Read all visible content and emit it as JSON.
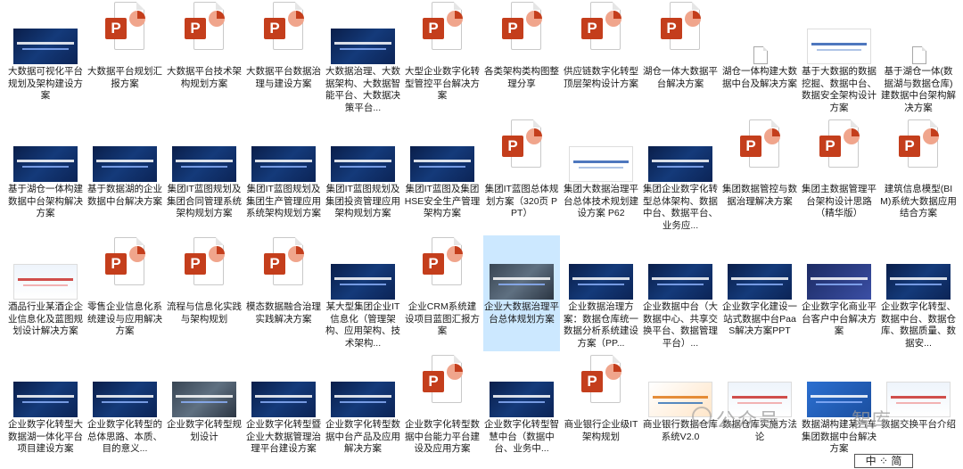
{
  "files": [
    {
      "row": 0,
      "col": 0,
      "thumb": "slide",
      "label": "大数据可视化平台规划及架构建设方案"
    },
    {
      "row": 0,
      "col": 1,
      "thumb": "ppt",
      "label": "大数据平台规划汇报方案"
    },
    {
      "row": 0,
      "col": 2,
      "thumb": "ppt",
      "label": "大数据平台技术架构规划方案"
    },
    {
      "row": 0,
      "col": 3,
      "thumb": "ppt",
      "label": "大数据平台数据治理与建设方案"
    },
    {
      "row": 0,
      "col": 4,
      "thumb": "slide",
      "label": "大数据治理、大数据架构、大数据智能平台、大数据决策平台..."
    },
    {
      "row": 0,
      "col": 5,
      "thumb": "ppt",
      "label": "大型企业数字化转型管控平台解决方案"
    },
    {
      "row": 0,
      "col": 6,
      "thumb": "ppt",
      "label": "各类架构类构图整理分享"
    },
    {
      "row": 0,
      "col": 7,
      "thumb": "ppt",
      "label": "供应链数字化转型顶层架构设计方案"
    },
    {
      "row": 0,
      "col": 8,
      "thumb": "ppt",
      "label": "湖仓一体大数据平台解决方案"
    },
    {
      "row": 0,
      "col": 9,
      "thumb": "doc",
      "label": "湖仓一体构建大数据中台及解决方案"
    },
    {
      "row": 0,
      "col": 10,
      "thumb": "slide-white",
      "label": "基于大数据的数据挖掘、数据中台、数据安全架构设计方案"
    },
    {
      "row": 0,
      "col": 11,
      "thumb": "doc",
      "label": "基于湖仓一体(数据湖与数据仓库)建数据中台架构解决方案"
    },
    {
      "row": 1,
      "col": 0,
      "thumb": "slide",
      "label": "基于湖仓一体构建数据中台架构解决方案"
    },
    {
      "row": 1,
      "col": 1,
      "thumb": "slide",
      "label": "基于数据湖的企业数据中台解决方案"
    },
    {
      "row": 1,
      "col": 2,
      "thumb": "slide",
      "label": "集团IT蓝图规划及集团合同管理系统架构规划方案"
    },
    {
      "row": 1,
      "col": 3,
      "thumb": "slide",
      "label": "集团IT蓝图规划及集团生产管理应用系统架构规划方案"
    },
    {
      "row": 1,
      "col": 4,
      "thumb": "slide",
      "label": "集团IT蓝图规划及集团投资管理应用架构规划方案"
    },
    {
      "row": 1,
      "col": 5,
      "thumb": "slide",
      "label": "集团IT蓝图及集团HSE安全生产管理架构方案"
    },
    {
      "row": 1,
      "col": 6,
      "thumb": "ppt",
      "label": "集团IT蓝图总体规划方案（320页 PPT）"
    },
    {
      "row": 1,
      "col": 7,
      "thumb": "slide-white",
      "label": "集团大数据治理平台总体技术规划建设方案 P62"
    },
    {
      "row": 1,
      "col": 8,
      "thumb": "slide",
      "label": "集团企业数字化转型总体架构、数据中台、数据平台、业务应..."
    },
    {
      "row": 1,
      "col": 9,
      "thumb": "ppt",
      "label": "集团数据管控与数据治理解决方案"
    },
    {
      "row": 1,
      "col": 10,
      "thumb": "ppt",
      "label": "集团主数据管理平台架构设计思路（精华版）"
    },
    {
      "row": 1,
      "col": 11,
      "thumb": "ppt",
      "label": "建筑信息模型(BIM)系统大数据应用结合方案"
    },
    {
      "row": 2,
      "col": 0,
      "thumb": "slide-light",
      "label": "酒品行业某酒企企业信息化及蓝图规划设计解决方案"
    },
    {
      "row": 2,
      "col": 1,
      "thumb": "ppt",
      "label": "零售企业信息化系统建设与应用解决方案"
    },
    {
      "row": 2,
      "col": 2,
      "thumb": "ppt",
      "label": "流程与信息化实践与架构规划"
    },
    {
      "row": 2,
      "col": 3,
      "thumb": "ppt",
      "label": "模态数据融合治理实践解决方案"
    },
    {
      "row": 2,
      "col": 4,
      "thumb": "slide",
      "label": "某大型集团企业IT信息化（管理架构、应用架构、技术架构..."
    },
    {
      "row": 2,
      "col": 5,
      "thumb": "ppt",
      "label": "企业CRM系统建设项目蓝图汇报方案"
    },
    {
      "row": 2,
      "col": 6,
      "thumb": "slide-gray",
      "label": "企业大数据治理平台总体规划方案",
      "selected": true
    },
    {
      "row": 2,
      "col": 7,
      "thumb": "slide",
      "label": "企业数据治理方案：数据仓库统一数据分析系统建设方案（PP..."
    },
    {
      "row": 2,
      "col": 8,
      "thumb": "slide",
      "label": "企业数据中台（大数据中心、共享交换平台、数据管理平台）..."
    },
    {
      "row": 2,
      "col": 9,
      "thumb": "slide",
      "label": "企业数字化建设一站式数据中台PaaS解决方案PPT"
    },
    {
      "row": 2,
      "col": 10,
      "thumb": "slide-navy",
      "label": "企业数字化商业平台客户中台解决方案"
    },
    {
      "row": 2,
      "col": 11,
      "thumb": "slide",
      "label": "企业数字化转型、数据中台、数据仓库、数据质量、数据安..."
    },
    {
      "row": 3,
      "col": 0,
      "thumb": "slide",
      "label": "企业数字化转型大数据湖一体化平台项目建设方案"
    },
    {
      "row": 3,
      "col": 1,
      "thumb": "slide",
      "label": "企业数字化转型的总体思路、本质、目的意义..."
    },
    {
      "row": 3,
      "col": 2,
      "thumb": "slide-gray",
      "label": "企业数字化转型规划设计"
    },
    {
      "row": 3,
      "col": 3,
      "thumb": "slide",
      "label": "企业数字化转型暨企业大数据管理治理平台建设方案"
    },
    {
      "row": 3,
      "col": 4,
      "thumb": "slide",
      "label": "企业数字化转型数据中台产品及应用解决方案"
    },
    {
      "row": 3,
      "col": 5,
      "thumb": "ppt",
      "label": "企业数字化转型数据中台能力平台建设及应用方案"
    },
    {
      "row": 3,
      "col": 6,
      "thumb": "slide",
      "label": "企业数字化转型智慧中台（数据中台、业务中..."
    },
    {
      "row": 3,
      "col": 7,
      "thumb": "ppt",
      "label": "商业银行企业级IT架构规划"
    },
    {
      "row": 3,
      "col": 8,
      "thumb": "slide-orange",
      "label": "商业银行数据仓库系统V2.0"
    },
    {
      "row": 3,
      "col": 9,
      "thumb": "slide-light",
      "label": "数据仓库实施方法论"
    },
    {
      "row": 3,
      "col": 10,
      "thumb": "slide-blue",
      "label": "数据湖构建某汽车集团数据中台解决方案"
    },
    {
      "row": 3,
      "col": 11,
      "thumb": "slide-light",
      "label": "数据交换平台介绍"
    }
  ],
  "ppt_badge": "P",
  "watermark": {
    "text": "公众号·",
    "text2": "智库"
  },
  "cursor_tooltip": "中 ⁘ 简",
  "colors": {
    "ppt_red": "#c43e1c",
    "selection": "#cce8ff"
  }
}
